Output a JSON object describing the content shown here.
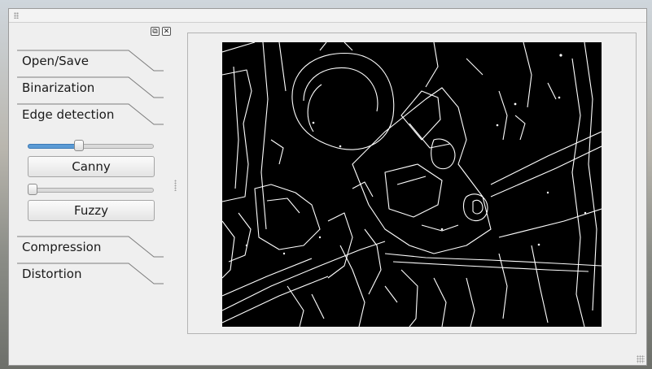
{
  "toolbox": {
    "sections": [
      {
        "label": "Open/Save"
      },
      {
        "label": "Binarization"
      },
      {
        "label": "Edge detection"
      },
      {
        "label": "Compression"
      },
      {
        "label": "Distortion"
      }
    ]
  },
  "edge_detection": {
    "canny_label": "Canny",
    "fuzzy_label": "Fuzzy",
    "canny_threshold_fraction": 0.4,
    "fuzzy_threshold_fraction": 0.0
  },
  "colors": {
    "accent": "#5b9bd5",
    "image_background": "#000000",
    "edge_lines": "#ffffff"
  },
  "icons": {
    "dock_float": "float-icon",
    "dock_close": "close-icon"
  }
}
